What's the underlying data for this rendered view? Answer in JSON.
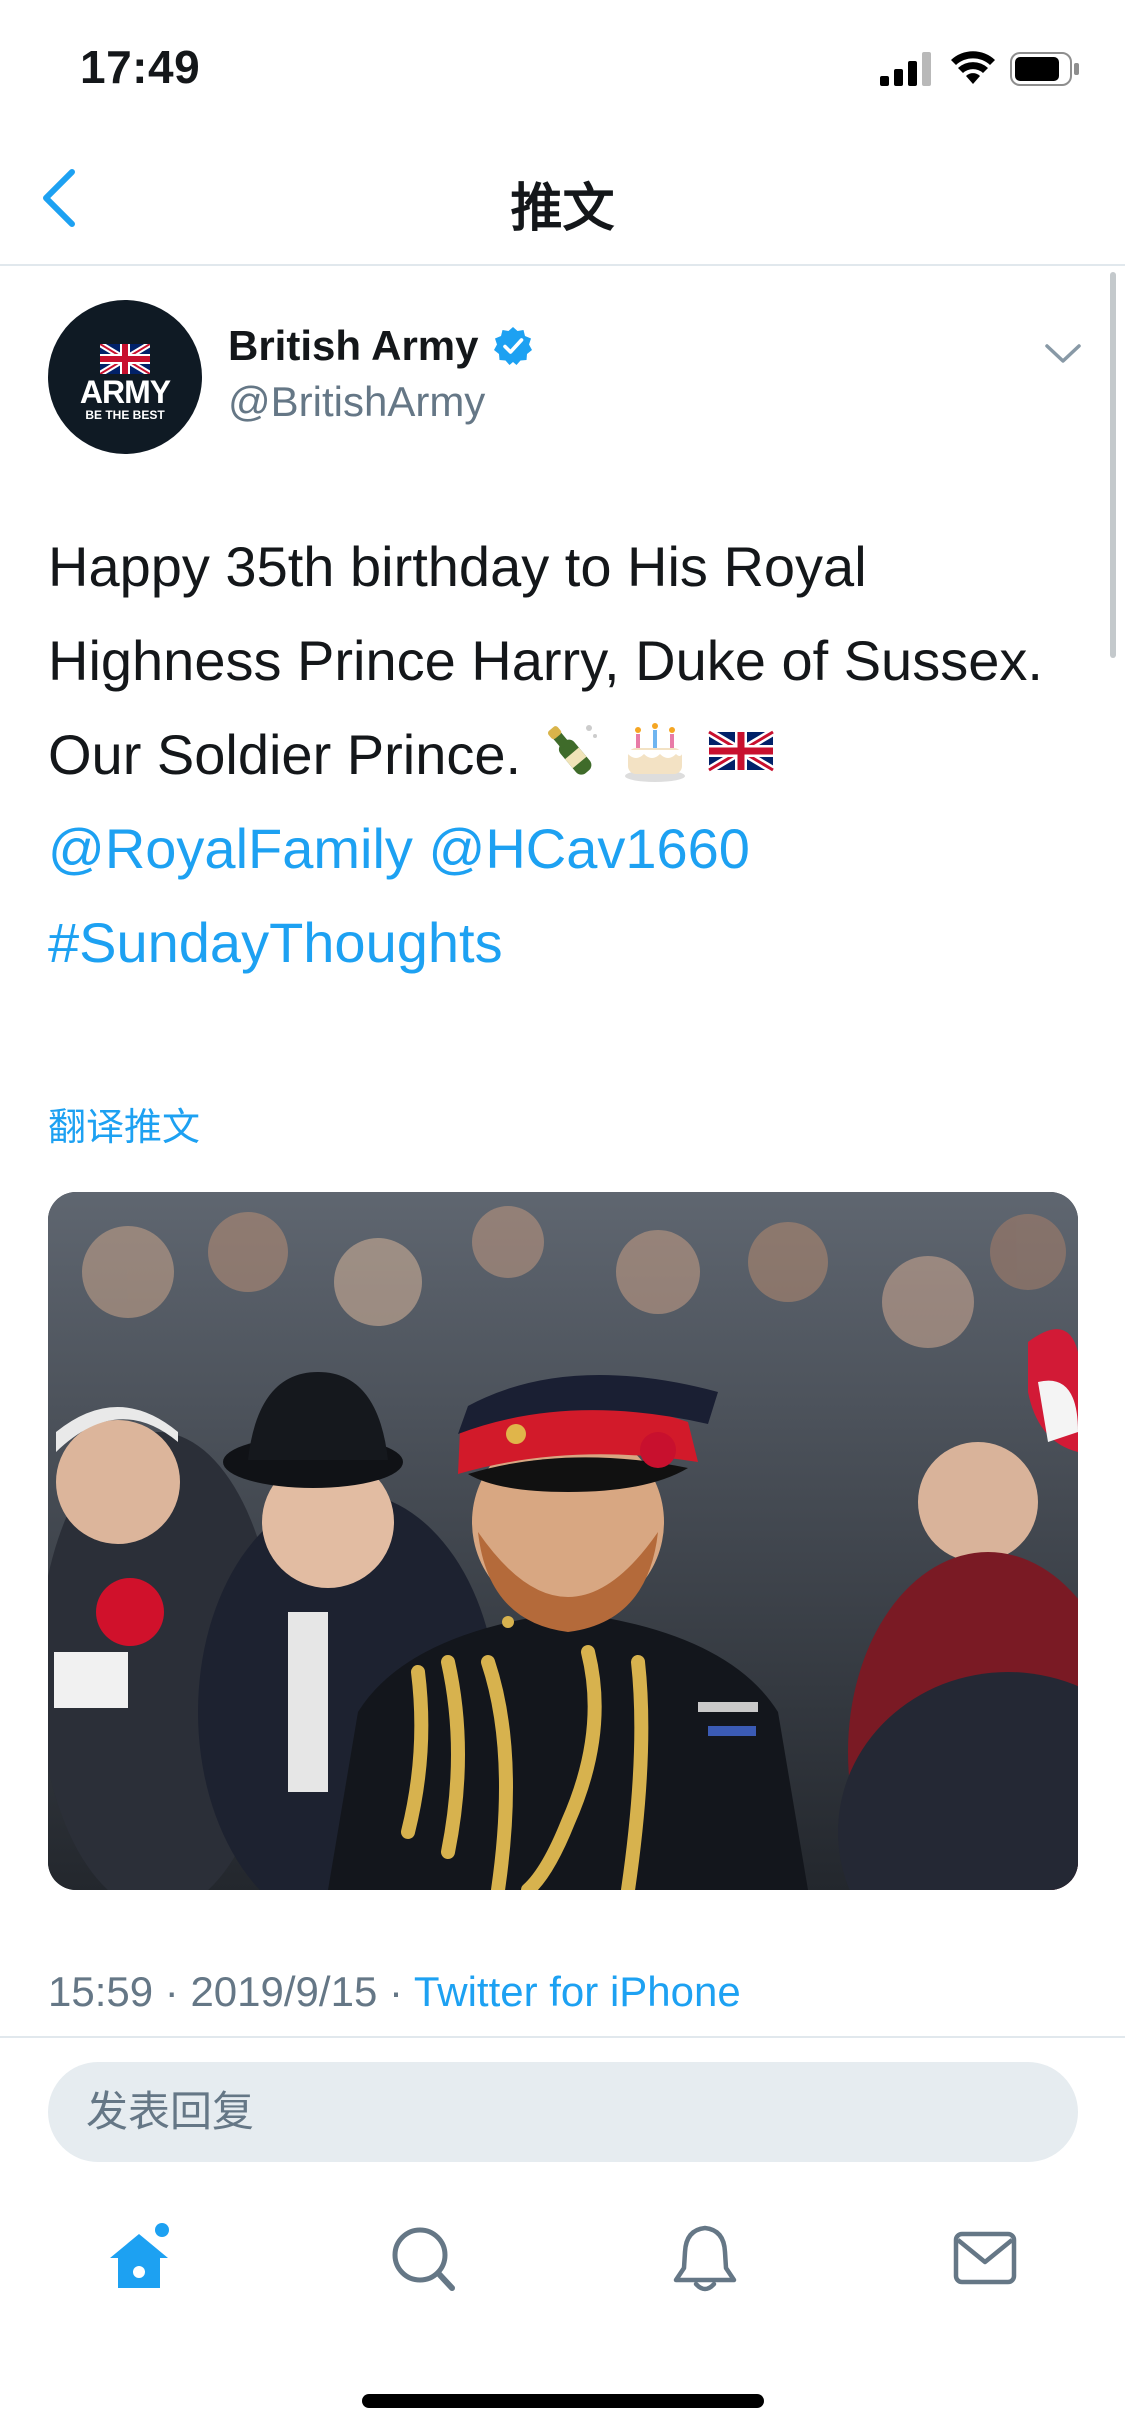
{
  "status_bar": {
    "time": "17:49"
  },
  "nav": {
    "title": "推文"
  },
  "tweet": {
    "author_name": "British Army",
    "handle": "@BritishArmy",
    "avatar_text": "ARMY",
    "avatar_subtext": "BE THE BEST",
    "text_plain": "Happy 35th birthday to His Royal Highness Prince Harry, Duke of Sussex. Our Soldier Prince.",
    "mention_1": "@RoyalFamily",
    "mention_2": "@HCav1660",
    "hashtag": "#SundayThoughts",
    "emojis": [
      "champagne-emoji",
      "birthday-cake-emoji",
      "uk-flag-emoji"
    ],
    "translate_label": "翻译推文",
    "time": "15:59",
    "date": "2019/9/15",
    "separator": "·",
    "source": "Twitter for iPhone"
  },
  "reply": {
    "placeholder": "发表回复"
  },
  "tabs": [
    "home-icon",
    "search-icon",
    "bell-icon",
    "mail-icon"
  ],
  "colors": {
    "accent": "#1da1f2",
    "muted": "#657786",
    "divider": "#e1e8ed"
  }
}
